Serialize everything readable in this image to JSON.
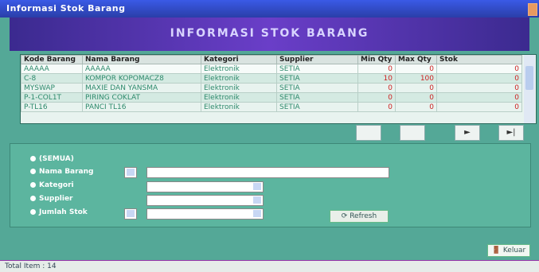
{
  "window": {
    "title": "Informasi Stok Barang"
  },
  "banner": {
    "title": "INFORMASI STOK BARANG"
  },
  "grid": {
    "headers": [
      "Kode Barang",
      "Nama Barang",
      "Kategori",
      "Supplier",
      "Min Qty",
      "Max Qty",
      "Stok"
    ],
    "rows": [
      [
        "AAAAA",
        "AAAAA",
        "Elektronik",
        "SETIA",
        "0",
        "0",
        "0"
      ],
      [
        "C-8",
        "KOMPOR KOPOMACZ8",
        "Elektronik",
        "SETIA",
        "10",
        "100",
        "0"
      ],
      [
        "MYSWAP",
        "MAXIE DAN YANSMA",
        "Elektronik",
        "SETIA",
        "0",
        "0",
        "0"
      ],
      [
        "P-1-COL1T",
        "PIRING COKLAT",
        "Elektronik",
        "SETIA",
        "0",
        "0",
        "0"
      ],
      [
        "P-TL16",
        "PANCI TL16",
        "Elektronik",
        "SETIA",
        "0",
        "0",
        "0"
      ]
    ]
  },
  "nav": {
    "next": "►",
    "last": "►|"
  },
  "filter": {
    "options": [
      "(SEMUA)",
      "Nama Barang",
      "Kategori",
      "Supplier",
      "Jumlah Stok"
    ],
    "refresh_label": "Refresh"
  },
  "buttons": {
    "keluar": "Keluar"
  },
  "status": {
    "text": "Total Item : 14"
  },
  "colors": {
    "banner": "#3b2a8f",
    "background": "#54a897",
    "negative": "#cc2222"
  }
}
